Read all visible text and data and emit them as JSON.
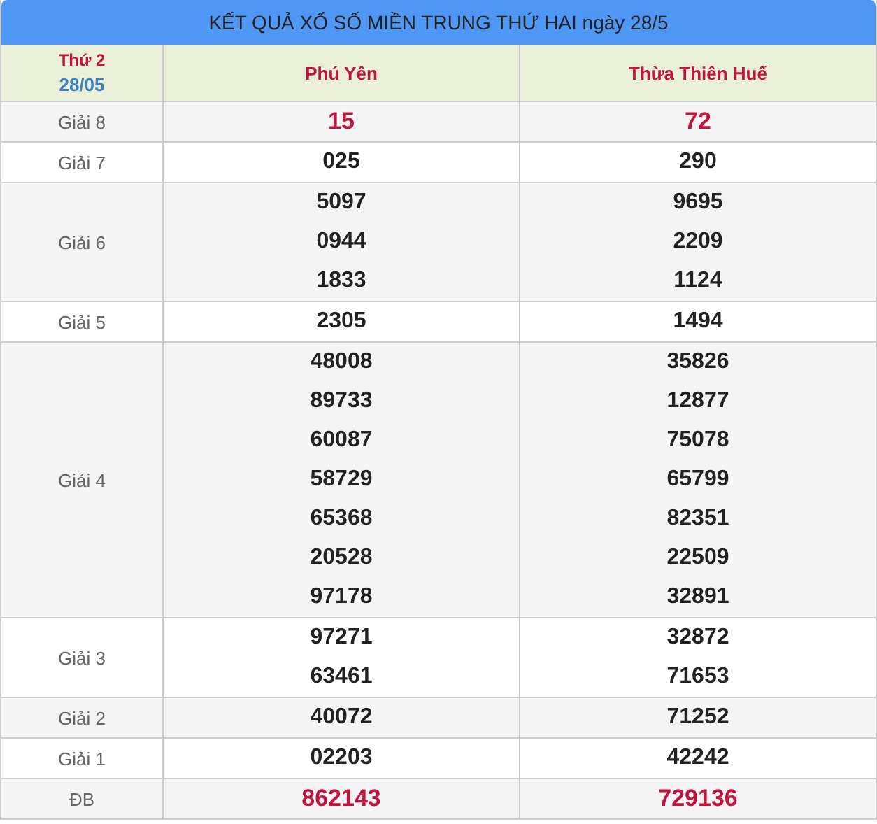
{
  "title": "KẾT QUẢ XỔ SỐ MIỀN TRUNG THỨ HAI ngày 28/5",
  "header": {
    "weekday": "Thứ 2",
    "date": "28/05",
    "provinces": [
      "Phú Yên",
      "Thừa Thiên Huế"
    ]
  },
  "rows": [
    {
      "prize": "Giải 8",
      "highlight": true,
      "results": [
        [
          "15"
        ],
        [
          "72"
        ]
      ]
    },
    {
      "prize": "Giải 7",
      "highlight": false,
      "results": [
        [
          "025"
        ],
        [
          "290"
        ]
      ]
    },
    {
      "prize": "Giải 6",
      "highlight": false,
      "results": [
        [
          "5097",
          "0944",
          "1833"
        ],
        [
          "9695",
          "2209",
          "1124"
        ]
      ]
    },
    {
      "prize": "Giải 5",
      "highlight": false,
      "results": [
        [
          "2305"
        ],
        [
          "1494"
        ]
      ]
    },
    {
      "prize": "Giải 4",
      "highlight": false,
      "results": [
        [
          "48008",
          "89733",
          "60087",
          "58729",
          "65368",
          "20528",
          "97178"
        ],
        [
          "35826",
          "12877",
          "75078",
          "65799",
          "82351",
          "22509",
          "32891"
        ]
      ]
    },
    {
      "prize": "Giải 3",
      "highlight": false,
      "results": [
        [
          "97271",
          "63461"
        ],
        [
          "32872",
          "71653"
        ]
      ]
    },
    {
      "prize": "Giải 2",
      "highlight": false,
      "results": [
        [
          "40072"
        ],
        [
          "71252"
        ]
      ]
    },
    {
      "prize": "Giải 1",
      "highlight": false,
      "results": [
        [
          "02203"
        ],
        [
          "42242"
        ]
      ]
    },
    {
      "prize": "ĐB",
      "highlight": true,
      "results": [
        [
          "862143"
        ],
        [
          "729136"
        ]
      ]
    }
  ]
}
